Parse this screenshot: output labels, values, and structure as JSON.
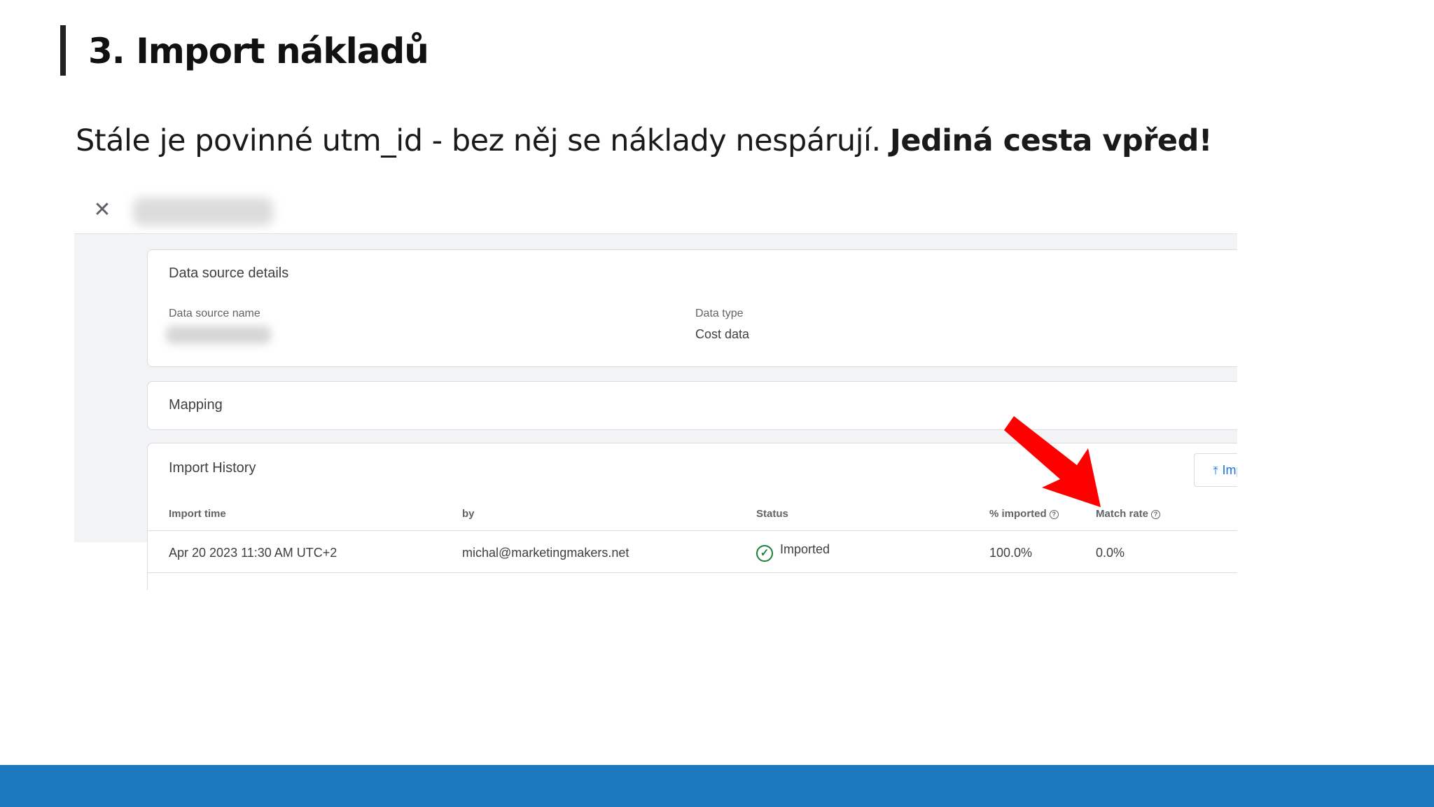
{
  "slide": {
    "title": "3. Import nákladů",
    "subtitle_regular": "Stále je povinné utm_id - bez něj se náklady nespárují. ",
    "subtitle_bold": "Jediná cesta vpřed!"
  },
  "screenshot": {
    "details_card": {
      "title": "Data source details",
      "name_label": "Data source name",
      "type_label": "Data type",
      "type_value": "Cost data"
    },
    "mapping_card": {
      "title": "Mapping"
    },
    "history_card": {
      "title": "Import History",
      "import_button": "Import now",
      "columns": [
        "Import time",
        "by",
        "Status",
        "% imported",
        "Match rate"
      ],
      "rows": [
        {
          "time": "Apr 20 2023 11:30 AM UTC+2",
          "by": "michal@marketingmakers.net",
          "status": "Imported",
          "imported": "100.0%",
          "match_rate": "0.0%"
        }
      ]
    }
  },
  "colors": {
    "footer_band": "#1c78bf",
    "annotation_arrow": "#ff0000",
    "accent_link": "#1a73e8",
    "status_ok": "#188038"
  },
  "icons": [
    "close-icon",
    "pencil-icon",
    "chevron-right-icon",
    "upload-icon",
    "help-icon",
    "check-circle-icon",
    "arrow-annotation"
  ]
}
